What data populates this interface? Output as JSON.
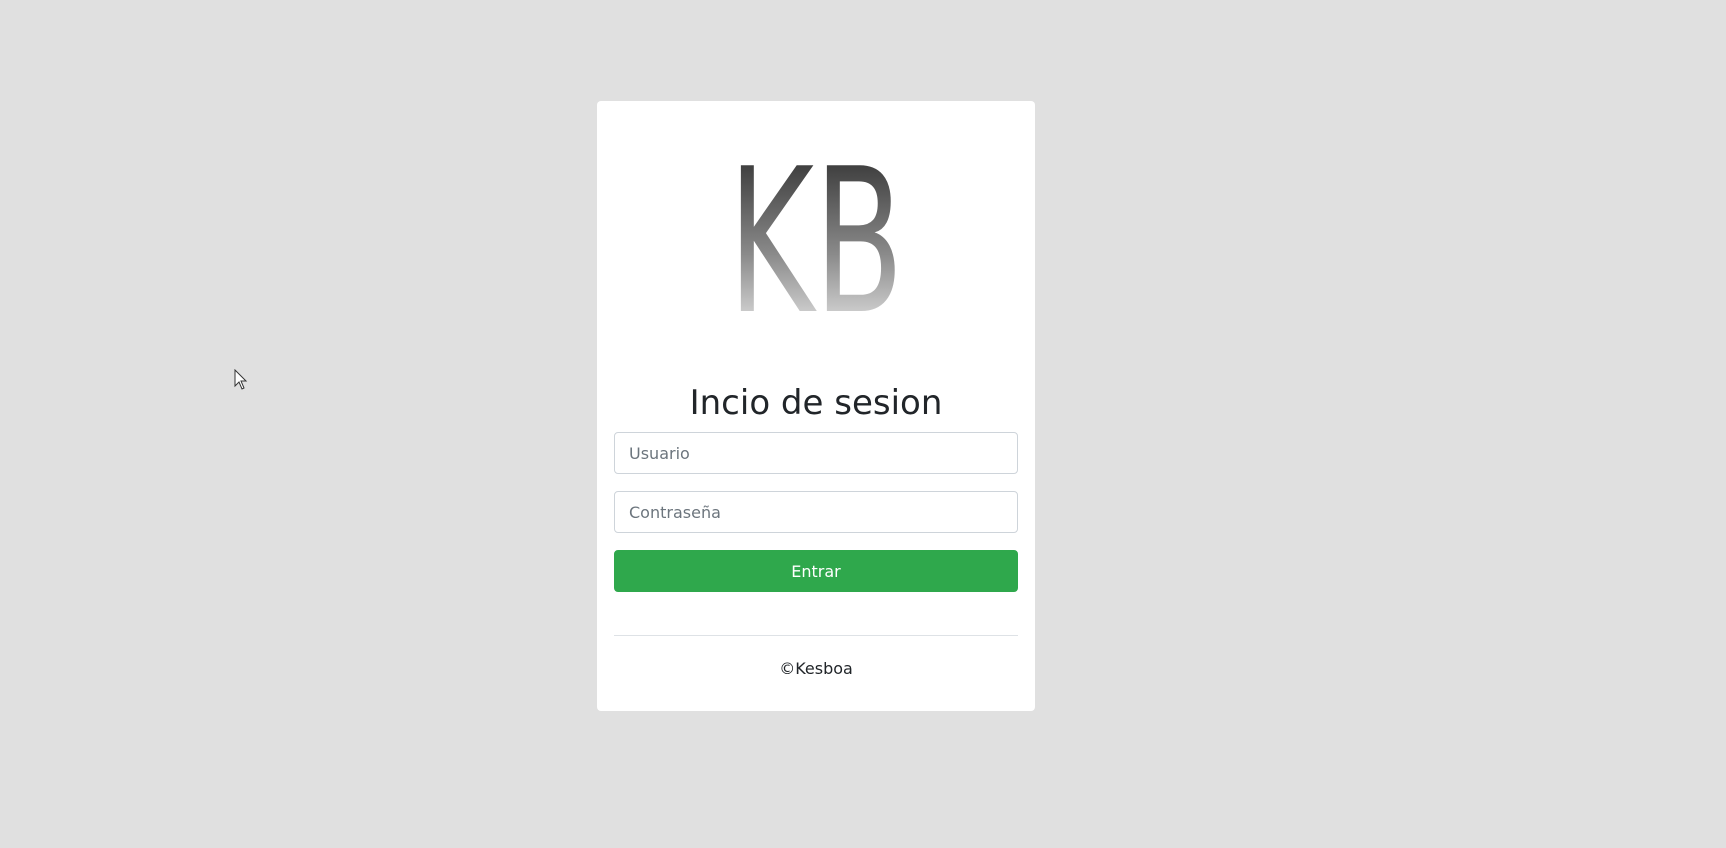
{
  "logo": {
    "text": "KB"
  },
  "login": {
    "title": "Incio de sesion",
    "username_placeholder": "Usuario",
    "password_placeholder": "Contraseña",
    "submit_label": "Entrar"
  },
  "footer": {
    "copyright": "©Kesboa"
  },
  "colors": {
    "background": "#e0e0e0",
    "card": "#ffffff",
    "button": "#2fa84c"
  }
}
